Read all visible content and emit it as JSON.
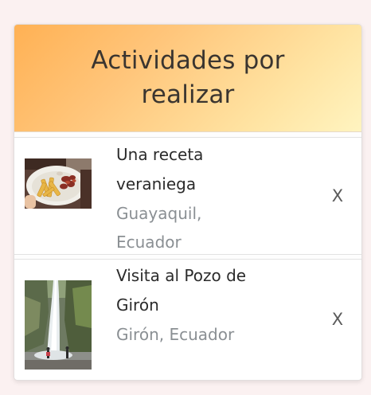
{
  "header": {
    "title_line1": "Actividades por",
    "title_line2": "realizar"
  },
  "activities": [
    {
      "title_line1": "Una receta",
      "title_line2": "veraniega",
      "location_line1": "Guayaquil,",
      "location_line2": "Ecuador",
      "close_label": "X",
      "image": "food-plate-photo"
    },
    {
      "title_line1": "Visita al Pozo de",
      "title_line2": "Girón",
      "location_line1": "Girón, Ecuador",
      "close_label": "X",
      "image": "waterfall-photo"
    }
  ],
  "colors": {
    "header_gradient_start": "#ffb154",
    "header_gradient_end": "#fff4c0",
    "title_text": "#2b2b2b",
    "location_text": "#8a8f93",
    "page_background": "#fbf1f1"
  }
}
